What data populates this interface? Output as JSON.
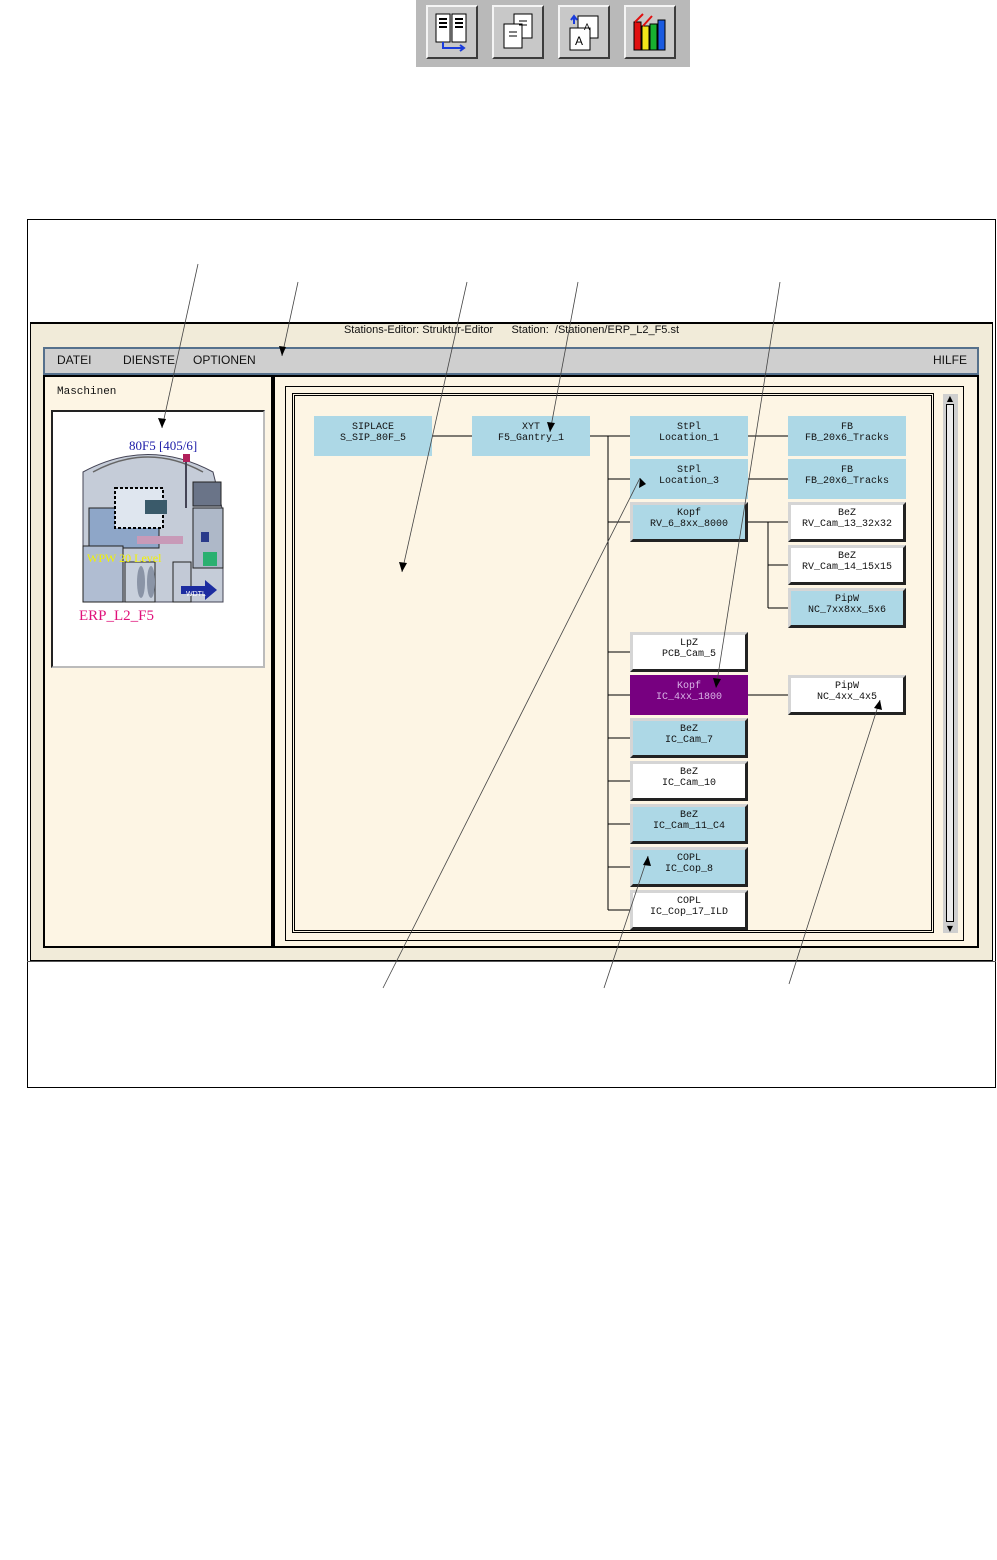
{
  "toolbar": {
    "buttons": [
      {
        "icon": "structure-doc-icon"
      },
      {
        "icon": "copy-doc-icon"
      },
      {
        "icon": "convert-doc-icon"
      },
      {
        "icon": "library-books-icon"
      }
    ]
  },
  "window": {
    "title": "Stations-Editor: Struktur-Editor      Station:  /Stationen/ERP_L2_F5.st"
  },
  "menu": {
    "items": [
      "DATEI",
      "DIENSTE",
      "OPTIONEN"
    ],
    "help": "HILFE"
  },
  "left_panel": {
    "header": "Maschinen",
    "machine": {
      "model_label": "80F5 [405/6]",
      "sublabel": "WPW  20 Level",
      "badge": "WDTL",
      "station_label": "ERP_L2_F5",
      "colors": {
        "model": "#1c1ca8",
        "sub": "#f2f200",
        "station": "#e0107a"
      }
    }
  },
  "tree": {
    "nodes": [
      {
        "id": "n1",
        "type": "SIPLACE",
        "name": "S_SIP_80F_5",
        "style": "flat"
      },
      {
        "id": "n2",
        "type": "XYT",
        "name": "F5_Gantry_1",
        "style": "flat"
      },
      {
        "id": "n3",
        "type": "StPl",
        "name": "Location_1",
        "style": "flat"
      },
      {
        "id": "n4",
        "type": "StPl",
        "name": "Location_3",
        "style": "flat"
      },
      {
        "id": "n5",
        "type": "Kopf",
        "name": "RV_6_8xx_8000",
        "style": "raised-blue"
      },
      {
        "id": "n6",
        "type": "LpZ",
        "name": "PCB_Cam_5",
        "style": "raised-white"
      },
      {
        "id": "n7",
        "type": "Kopf",
        "name": "IC_4xx_1800",
        "style": "purple"
      },
      {
        "id": "n8",
        "type": "BeZ",
        "name": "IC_Cam_7",
        "style": "raised-blue"
      },
      {
        "id": "n9",
        "type": "BeZ",
        "name": "IC_Cam_10",
        "style": "raised-white"
      },
      {
        "id": "n10",
        "type": "BeZ",
        "name": "IC_Cam_11_C4",
        "style": "raised-blue"
      },
      {
        "id": "n11",
        "type": "COPL",
        "name": "IC_Cop_8",
        "style": "raised-blue"
      },
      {
        "id": "n12",
        "type": "COPL",
        "name": "IC_Cop_17_ILD",
        "style": "raised-white"
      },
      {
        "id": "n13",
        "type": "FB",
        "name": "FB_20x6_Tracks",
        "style": "flat"
      },
      {
        "id": "n14",
        "type": "FB",
        "name": "FB_20x6_Tracks",
        "style": "flat"
      },
      {
        "id": "n15",
        "type": "BeZ",
        "name": "RV_Cam_13_32x32",
        "style": "raised-white"
      },
      {
        "id": "n16",
        "type": "BeZ",
        "name": "RV_Cam_14_15x15",
        "style": "raised-white"
      },
      {
        "id": "n17",
        "type": "PipW",
        "name": "NC_7xx8xx_5x6",
        "style": "raised-blue"
      },
      {
        "id": "n18",
        "type": "PipW",
        "name": "NC_4xx_4x5",
        "style": "raised-white"
      }
    ]
  }
}
